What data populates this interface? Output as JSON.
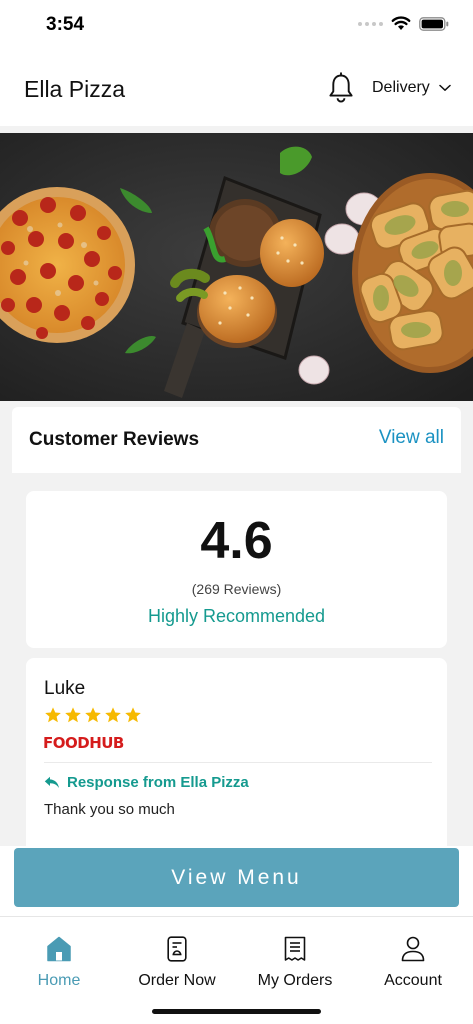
{
  "status_bar": {
    "time": "3:54"
  },
  "header": {
    "title": "Ella Pizza",
    "delivery_label": "Delivery"
  },
  "reviews": {
    "title": "Customer Reviews",
    "view_all": "View all",
    "rating": "4.6",
    "count_text": "(269 Reviews)",
    "recommendation": "Highly Recommended",
    "review": {
      "name": "Luke",
      "stars": 5,
      "source": "FOODHUB",
      "response_label": "Response from Ella Pizza",
      "response_text": "Thank you so much"
    }
  },
  "cta": {
    "label": "View Menu"
  },
  "tabs": [
    {
      "label": "Home",
      "icon": "home-icon",
      "active": true
    },
    {
      "label": "Order Now",
      "icon": "menu-card-icon",
      "active": false
    },
    {
      "label": "My Orders",
      "icon": "receipt-icon",
      "active": false
    },
    {
      "label": "Account",
      "icon": "user-icon",
      "active": false
    }
  ],
  "colors": {
    "accent": "#5ba4bb",
    "link": "#1b92c2",
    "teal": "#159a8f",
    "star": "#f6b900",
    "foodhub": "#d51c1c"
  }
}
